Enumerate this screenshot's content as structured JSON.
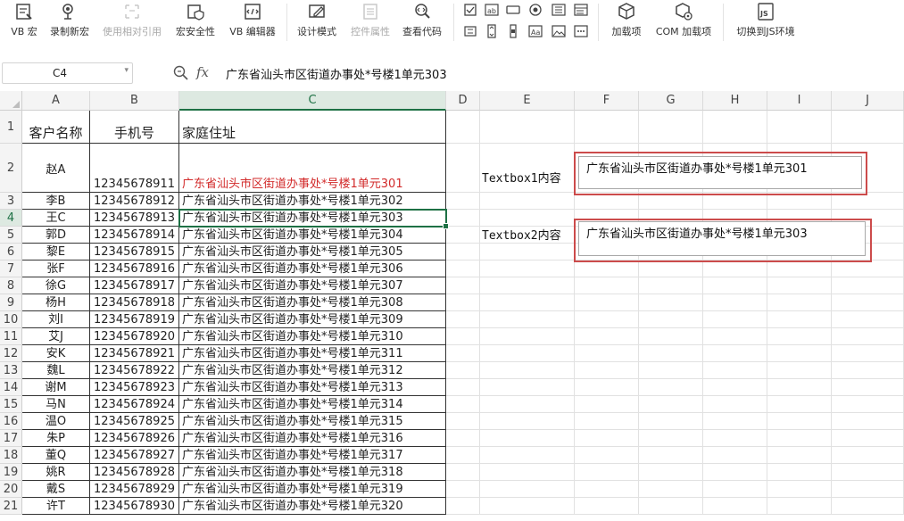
{
  "ribbon": {
    "buttons": [
      {
        "label": "VB 宏",
        "icon": "vb-macro-icon",
        "disabled": false
      },
      {
        "label": "录制新宏",
        "icon": "record-macro-icon",
        "disabled": false
      },
      {
        "label": "使用相对引用",
        "icon": "relative-reference-icon",
        "disabled": true
      },
      {
        "label": "宏安全性",
        "icon": "macro-security-icon",
        "disabled": false
      },
      {
        "label": "VB 编辑器",
        "icon": "vb-editor-icon",
        "disabled": false
      },
      {
        "label": "设计模式",
        "icon": "design-mode-icon",
        "disabled": false
      },
      {
        "label": "控件属性",
        "icon": "control-properties-icon",
        "disabled": true
      },
      {
        "label": "查看代码",
        "icon": "view-code-icon",
        "disabled": false
      },
      {
        "label": "加载项",
        "icon": "add-ins-icon",
        "disabled": false
      },
      {
        "label": "COM 加载项",
        "icon": "com-add-ins-icon",
        "disabled": false
      },
      {
        "label": "切换到JS环境",
        "icon": "switch-js-icon",
        "disabled": false
      }
    ],
    "controls_row1": [
      "checkbox-control-icon",
      "label-control-icon",
      "button-control-icon",
      "option-button-icon",
      "listbox-control-icon",
      "combobox-control-icon"
    ],
    "controls_row2": [
      "scrollbar-control-icon",
      "spinner-control-icon",
      "slider-control-icon",
      "textbox-control-icon",
      "image-control-icon",
      "more-controls-icon"
    ],
    "colors": {
      "accent": "#1e7145",
      "highlight_red": "#cc4b4b",
      "text_red": "#d22a2a"
    }
  },
  "formula_bar": {
    "name_box": "C4",
    "fx_label": "fx",
    "content": "广东省汕头市区街道办事处*号楼1单元303"
  },
  "sheet": {
    "selected_cell": "C4",
    "columns": [
      "A",
      "B",
      "C",
      "D",
      "E",
      "F",
      "G",
      "H",
      "I",
      "J"
    ],
    "rows": [
      "1",
      "2",
      "3",
      "4",
      "5",
      "6",
      "7",
      "8",
      "9",
      "10",
      "11",
      "12",
      "13",
      "14",
      "15",
      "16",
      "17",
      "18",
      "19",
      "20",
      "21"
    ],
    "headers": [
      "客户名称",
      "手机号",
      "家庭住址"
    ],
    "data": [
      [
        "赵A",
        "12345678911",
        "广东省汕头市区街道办事处*号楼1单元301"
      ],
      [
        "李B",
        "12345678912",
        "广东省汕头市区街道办事处*号楼1单元302"
      ],
      [
        "王C",
        "12345678913",
        "广东省汕头市区街道办事处*号楼1单元303"
      ],
      [
        "郭D",
        "12345678914",
        "广东省汕头市区街道办事处*号楼1单元304"
      ],
      [
        "黎E",
        "12345678915",
        "广东省汕头市区街道办事处*号楼1单元305"
      ],
      [
        "张F",
        "12345678916",
        "广东省汕头市区街道办事处*号楼1单元306"
      ],
      [
        "徐G",
        "12345678917",
        "广东省汕头市区街道办事处*号楼1单元307"
      ],
      [
        "杨H",
        "12345678918",
        "广东省汕头市区街道办事处*号楼1单元308"
      ],
      [
        "刘I",
        "12345678919",
        "广东省汕头市区街道办事处*号楼1单元309"
      ],
      [
        "艾J",
        "12345678920",
        "广东省汕头市区街道办事处*号楼1单元310"
      ],
      [
        "安K",
        "12345678921",
        "广东省汕头市区街道办事处*号楼1单元311"
      ],
      [
        "魏L",
        "12345678922",
        "广东省汕头市区街道办事处*号楼1单元312"
      ],
      [
        "谢M",
        "12345678923",
        "广东省汕头市区街道办事处*号楼1单元313"
      ],
      [
        "马N",
        "12345678924",
        "广东省汕头市区街道办事处*号楼1单元314"
      ],
      [
        "温O",
        "12345678925",
        "广东省汕头市区街道办事处*号楼1单元315"
      ],
      [
        "朱P",
        "12345678926",
        "广东省汕头市区街道办事处*号楼1单元316"
      ],
      [
        "董Q",
        "12345678927",
        "广东省汕头市区街道办事处*号楼1单元317"
      ],
      [
        "姚R",
        "12345678928",
        "广东省汕头市区街道办事处*号楼1单元318"
      ],
      [
        "戴S",
        "12345678929",
        "广东省汕头市区街道办事处*号楼1单元319"
      ],
      [
        "许T",
        "12345678930",
        "广东省汕头市区街道办事处*号楼1单元320"
      ]
    ],
    "textboxes": [
      {
        "label": "Textbox1内容",
        "value": "广东省汕头市区街道办事处*号楼1单元301"
      },
      {
        "label": "Textbox2内容",
        "value": "广东省汕头市区街道办事处*号楼1单元303"
      }
    ]
  }
}
